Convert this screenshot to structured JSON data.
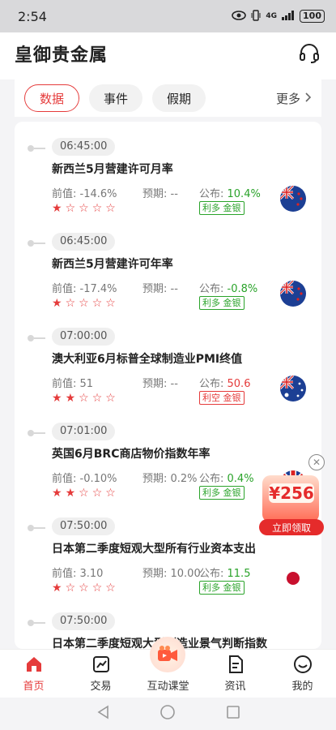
{
  "status_bar": {
    "time": "2:54",
    "network": "4G",
    "battery": "100"
  },
  "header": {
    "title": "皇御贵金属",
    "support_icon": "headset-icon"
  },
  "tabs": [
    {
      "label": "数据",
      "active": true
    },
    {
      "label": "事件",
      "active": false
    },
    {
      "label": "假期",
      "active": false
    }
  ],
  "more_label": "更多",
  "events": [
    {
      "time": "06:45:00",
      "name": "新西兰5月营建许可月率",
      "prev": "前值: -14.6%",
      "forecast": "预期: --",
      "actual_label": "公布: ",
      "actual_value": "10.4%",
      "actual_color": "green",
      "badge": "利多 金银",
      "badge_color": "green",
      "stars": 1,
      "flag": "new-zealand"
    },
    {
      "time": "06:45:00",
      "name": "新西兰5月营建许可年率",
      "prev": "前值: -17.4%",
      "forecast": "预期: --",
      "actual_label": "公布: ",
      "actual_value": "-0.8%",
      "actual_color": "green",
      "badge": "利多 金银",
      "badge_color": "green",
      "stars": 1,
      "flag": "new-zealand"
    },
    {
      "time": "07:00:00",
      "name": "澳大利亚6月标普全球制造业PMI终值",
      "prev": "前值: 51",
      "forecast": "预期: --",
      "actual_label": "公布: ",
      "actual_value": "50.6",
      "actual_color": "red",
      "badge": "利空 金银",
      "badge_color": "red",
      "stars": 2,
      "flag": "australia"
    },
    {
      "time": "07:01:00",
      "name": "英国6月BRC商店物价指数年率",
      "prev": "前值: -0.10%",
      "forecast": "预期: 0.2%",
      "actual_label": "公布: ",
      "actual_value": "0.4%",
      "actual_color": "green",
      "badge": "利多 金银",
      "badge_color": "green",
      "stars": 2,
      "flag": "uk"
    },
    {
      "time": "07:50:00",
      "name": "日本第二季度短观大型所有行业资本支出",
      "prev": "前值: 3.10",
      "forecast": "预期: 10.00",
      "actual_label": "公布: ",
      "actual_value": "11.5",
      "actual_color": "green",
      "badge": "利多 金银",
      "badge_color": "green",
      "stars": 1,
      "flag": "japan"
    },
    {
      "time": "07:50:00",
      "name": "日本第二季度短观大型制造业景气判断指数",
      "prev": "",
      "forecast": "",
      "actual_label": "",
      "actual_value": "",
      "actual_color": "green",
      "badge": "",
      "badge_color": "green",
      "stars": 0,
      "flag": ""
    }
  ],
  "promo": {
    "amount": "¥256",
    "button": "立即领取"
  },
  "bottom_nav": [
    {
      "label": "首页",
      "icon": "home-icon",
      "active": true
    },
    {
      "label": "交易",
      "icon": "trade-chart-icon",
      "active": false
    },
    {
      "label": "互动课堂",
      "icon": "video-camera-icon",
      "active": false
    },
    {
      "label": "资讯",
      "icon": "news-document-icon",
      "active": false
    },
    {
      "label": "我的",
      "icon": "smile-profile-icon",
      "active": false
    }
  ],
  "colors": {
    "accent": "#e53b3b",
    "bullish": "#2aa32a"
  }
}
